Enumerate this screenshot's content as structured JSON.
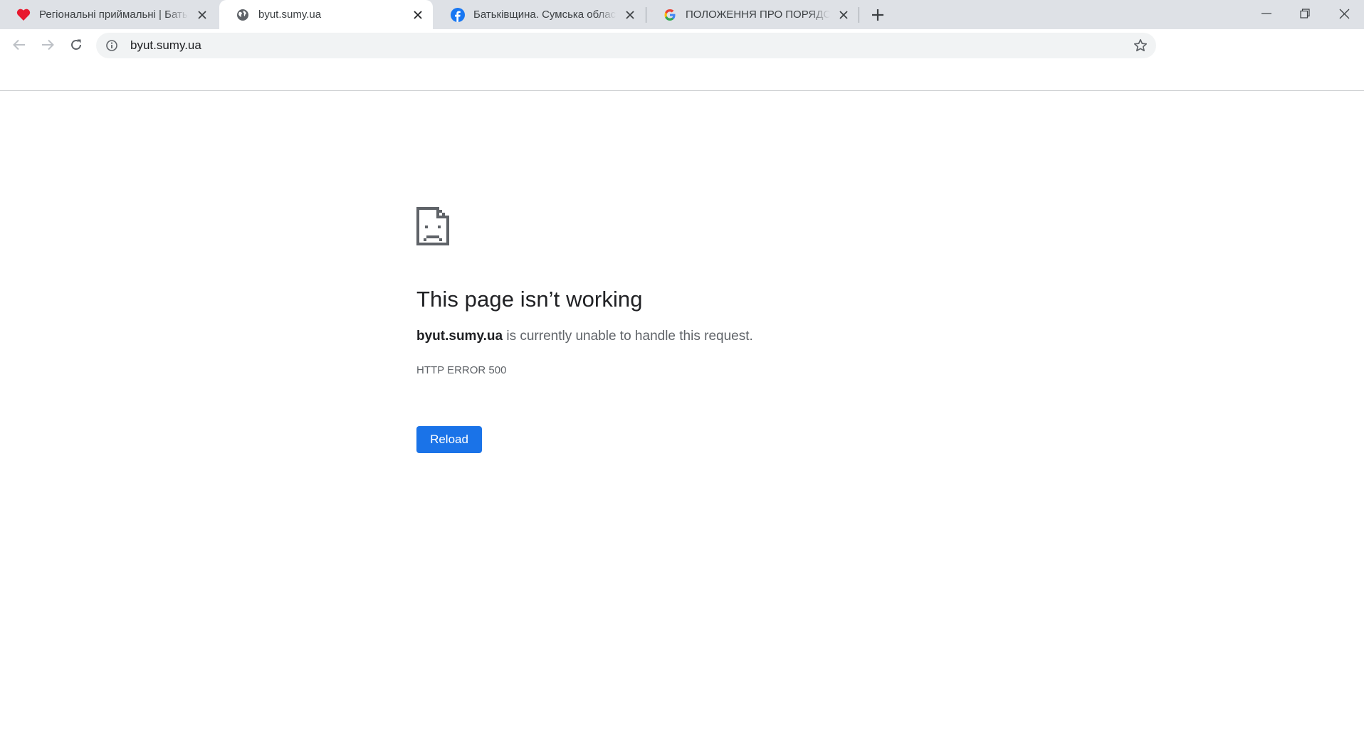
{
  "tabs": [
    {
      "title": "Регіональні приймальні | Батьківщина",
      "favicon": "heart-icon",
      "active": false
    },
    {
      "title": "byut.sumy.ua",
      "favicon": "globe-icon",
      "active": true
    },
    {
      "title": "Батьківщина. Сумська область | Facebook",
      "favicon": "facebook-icon",
      "active": false
    },
    {
      "title": "ПОЛОЖЕННЯ ПРО ПОРЯДОК",
      "favicon": "google-icon",
      "active": false
    }
  ],
  "address_bar": {
    "url": "byut.sumy.ua"
  },
  "error_page": {
    "heading": "This page isn’t working",
    "host": "byut.sumy.ua",
    "message": " is currently unable to handle this request.",
    "error_code": "HTTP ERROR 500",
    "reload_label": "Reload"
  },
  "colors": {
    "tab_strip": "#dee1e6",
    "reload_button": "#1a73e8",
    "heart": "#e8182e",
    "facebook": "#1877f2"
  }
}
